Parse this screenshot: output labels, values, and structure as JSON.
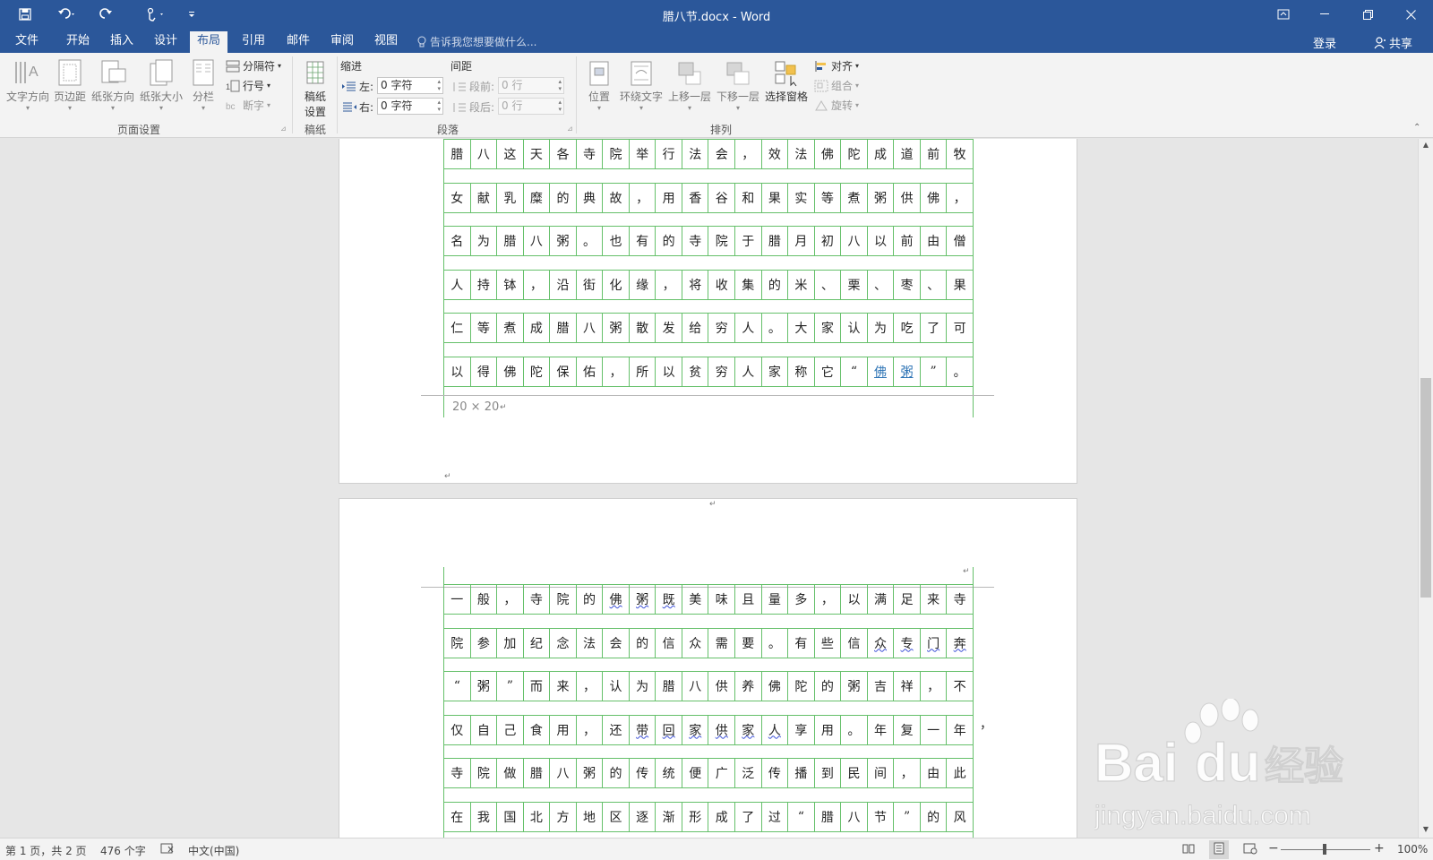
{
  "titlebar": {
    "title": "腊八节.docx - Word"
  },
  "tabs": [
    {
      "label": "文件"
    },
    {
      "label": "开始"
    },
    {
      "label": "插入"
    },
    {
      "label": "设计"
    },
    {
      "label": "布局"
    },
    {
      "label": "引用"
    },
    {
      "label": "邮件"
    },
    {
      "label": "审阅"
    },
    {
      "label": "视图"
    }
  ],
  "tellme": "告诉我您想要做什么...",
  "account": {
    "login": "登录",
    "share": "共享"
  },
  "ribbon": {
    "page_setup": {
      "text_direction": "文字方向",
      "margins": "页边距",
      "orientation": "纸张方向",
      "size": "纸张大小",
      "columns": "分栏",
      "breaks": "分隔符",
      "line_numbers": "行号",
      "hyphenation": "断字",
      "group": "页面设置"
    },
    "manuscript": {
      "button_line1": "稿纸",
      "button_line2": "设置",
      "group": "稿纸"
    },
    "paragraph": {
      "indent_title": "缩进",
      "spacing_title": "间距",
      "left_label": "左:",
      "right_label": "右:",
      "left_value": "0 字符",
      "right_value": "0 字符",
      "before_label": "段前:",
      "after_label": "段后:",
      "before_value": "0 行",
      "after_value": "0 行",
      "group": "段落"
    },
    "arrange": {
      "position": "位置",
      "wrap_text": "环绕文字",
      "bring_forward": "上移一层",
      "send_backward": "下移一层",
      "selection_pane": "选择窗格",
      "align": "对齐",
      "group_btn": "组合",
      "rotate": "旋转",
      "group": "排列"
    }
  },
  "document": {
    "page1_lines": [
      [
        "腊",
        "八",
        "这",
        "天",
        "各",
        "寺",
        "院",
        "举",
        "行",
        "法",
        "会",
        "，",
        "效",
        "法",
        "佛",
        "陀",
        "成",
        "道",
        "前",
        "牧"
      ],
      [
        "女",
        "献",
        "乳",
        "糜",
        "的",
        "典",
        "故",
        "，",
        "用",
        "香",
        "谷",
        "和",
        "果",
        "实",
        "等",
        "煮",
        "粥",
        "供",
        "佛",
        "，"
      ],
      [
        "名",
        "为",
        "腊",
        "八",
        "粥",
        "。",
        "也",
        "有",
        "的",
        "寺",
        "院",
        "于",
        "腊",
        "月",
        "初",
        "八",
        "以",
        "前",
        "由",
        "僧"
      ],
      [
        "人",
        "持",
        "钵",
        "，",
        "沿",
        "街",
        "化",
        "缘",
        "，",
        "将",
        "收",
        "集",
        "的",
        "米",
        "、",
        "栗",
        "、",
        "枣",
        "、",
        "果"
      ],
      [
        "仁",
        "等",
        "煮",
        "成",
        "腊",
        "八",
        "粥",
        "散",
        "发",
        "给",
        "穷",
        "人",
        "。",
        "大",
        "家",
        "认",
        "为",
        "吃",
        "了",
        "可"
      ],
      [
        "以",
        "得",
        "佛",
        "陀",
        "保",
        "佑",
        "，",
        "所",
        "以",
        "贫",
        "穷",
        "人",
        "家",
        "称",
        "它",
        "“",
        "佛",
        "粥",
        "”",
        "。"
      ]
    ],
    "grid_size": "20 × 20",
    "page2_lines": [
      [
        "一",
        "般",
        "，",
        "寺",
        "院",
        "的",
        "佛",
        "粥",
        "既",
        "美",
        "味",
        "且",
        "量",
        "多",
        "，",
        "以",
        "满",
        "足",
        "来",
        "寺"
      ],
      [
        "院",
        "参",
        "加",
        "纪",
        "念",
        "法",
        "会",
        "的",
        "信",
        "众",
        "需",
        "要",
        "。",
        "有",
        "些",
        "信",
        "众",
        "专",
        "门",
        "奔"
      ],
      [
        "“",
        "粥",
        "”",
        "而",
        "来",
        "，",
        "认",
        "为",
        "腊",
        "八",
        "供",
        "养",
        "佛",
        "陀",
        "的",
        "粥",
        "吉",
        "祥",
        "，",
        "不"
      ],
      [
        "仅",
        "自",
        "己",
        "食",
        "用",
        "，",
        "还",
        "带",
        "回",
        "家",
        "供",
        "家",
        "人",
        "享",
        "用",
        "。",
        "年",
        "复",
        "一",
        "年"
      ],
      [
        "寺",
        "院",
        "做",
        "腊",
        "八",
        "粥",
        "的",
        "传",
        "统",
        "便",
        "广",
        "泛",
        "传",
        "播",
        "到",
        "民",
        "间",
        "，",
        "由",
        "此"
      ],
      [
        "在",
        "我",
        "国",
        "北",
        "方",
        "地",
        "区",
        "逐",
        "渐",
        "形",
        "成",
        "了",
        "过",
        "“",
        "腊",
        "八",
        "节",
        "”",
        "的",
        "风"
      ]
    ],
    "overflow_char": "，"
  },
  "statusbar": {
    "page": "第 1 页，共 2 页",
    "words": "476 个字",
    "language": "中文(中国)",
    "zoom": "100%"
  },
  "watermark": {
    "text": "Baidu经验",
    "url": "jingyan.baidu.com"
  },
  "colors": {
    "brand": "#2b579a",
    "grid": "#65c06a",
    "link": "#2e74b5"
  }
}
